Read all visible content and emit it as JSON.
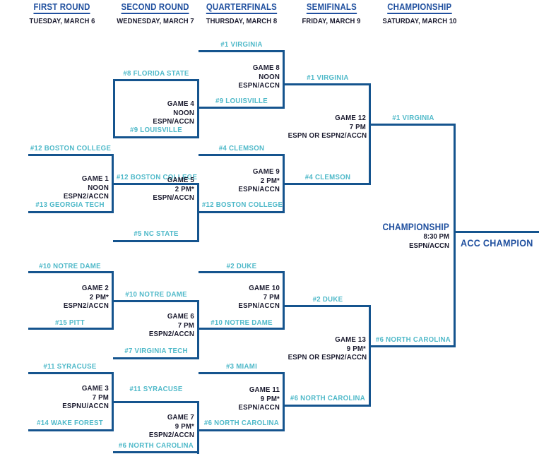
{
  "colors": {
    "header_blue": "#20509f",
    "line_navy": "#15548e",
    "team_teal": "#4fb9c9",
    "info_dark": "#1a1a2e",
    "background": "#ffffff"
  },
  "rounds": [
    {
      "title": "FIRST ROUND",
      "date": "TUESDAY, MARCH 6"
    },
    {
      "title": "SECOND ROUND",
      "date": "WEDNESDAY, MARCH 7"
    },
    {
      "title": "QUARTERFINALS",
      "date": "THURSDAY, MARCH 8"
    },
    {
      "title": "SEMIFINALS",
      "date": "FRIDAY, MARCH 9"
    },
    {
      "title": "CHAMPIONSHIP",
      "date": "SATURDAY, MARCH 10"
    }
  ],
  "games": {
    "g1": {
      "name": "GAME 1",
      "time": "NOON",
      "network": "ESPN2/ACCN",
      "top": "#12 BOSTON COLLEGE",
      "bottom": "#13 GEORGIA TECH",
      "winner": "#12 BOSTON COLLEGE"
    },
    "g2": {
      "name": "GAME 2",
      "time": "2 PM*",
      "network": "ESPN2/ACCN",
      "top": "#10 NOTRE DAME",
      "bottom": "#15 PITT",
      "winner": "#10 NOTRE DAME"
    },
    "g3": {
      "name": "GAME 3",
      "time": "7 PM",
      "network": "ESPNU/ACCN",
      "top": "#11 SYRACUSE",
      "bottom": "#14 WAKE FOREST",
      "winner": "#11 SYRACUSE"
    },
    "g4": {
      "name": "GAME 4",
      "time": "NOON",
      "network": "ESPN/ACCN",
      "top": "#8 FLORIDA STATE",
      "bottom": "#9 LOUISVILLE",
      "winner": "#9 LOUISVILLE"
    },
    "g5": {
      "name": "GAME 5",
      "time": "2 PM*",
      "network": "ESPN/ACCN",
      "top": "#12 BOSTON COLLEGE",
      "bottom": "#5 NC STATE",
      "winner": "#12 BOSTON COLLEGE"
    },
    "g6": {
      "name": "GAME 6",
      "time": "7 PM",
      "network": "ESPN2/ACCN",
      "top": "#10 NOTRE DAME",
      "bottom": "#7 VIRGINIA TECH",
      "winner": "#10 NOTRE DAME"
    },
    "g7": {
      "name": "GAME 7",
      "time": "9 PM*",
      "network": "ESPN2/ACCN",
      "top": "#11 SYRACUSE",
      "bottom": "#6 NORTH CAROLINA",
      "winner": "#6 NORTH CAROLINA"
    },
    "g8": {
      "name": "GAME 8",
      "time": "NOON",
      "network": "ESPN/ACCN",
      "top": "#1 VIRGINIA",
      "bottom": "#9 LOUISVILLE",
      "winner": "#1 VIRGINIA"
    },
    "g9": {
      "name": "GAME 9",
      "time": "2 PM*",
      "network": "ESPN/ACCN",
      "top": "#4 CLEMSON",
      "bottom": "#12 BOSTON COLLEGE",
      "winner": "#4 CLEMSON"
    },
    "g10": {
      "name": "GAME 10",
      "time": "7 PM",
      "network": "ESPN/ACCN",
      "top": "#2 DUKE",
      "bottom": "#10 NOTRE DAME",
      "winner": "#2 DUKE"
    },
    "g11": {
      "name": "GAME 11",
      "time": "9 PM*",
      "network": "ESPN/ACCN",
      "top": "#3 MIAMI",
      "bottom": "#6 NORTH CAROLINA",
      "winner": "#6 NORTH CAROLINA"
    },
    "g12": {
      "name": "GAME 12",
      "time": "7 PM",
      "network": "ESPN OR ESPN2/ACCN",
      "top": "#1 VIRGINIA",
      "bottom": "#4 CLEMSON",
      "winner": "#1 VIRGINIA"
    },
    "g13": {
      "name": "GAME 13",
      "time": "9 PM*",
      "network": "ESPN OR ESPN2/ACCN",
      "top": "#2 DUKE",
      "bottom": "#6 NORTH CAROLINA",
      "winner": "#6 NORTH CAROLINA"
    }
  },
  "championship": {
    "label": "CHAMPIONSHIP",
    "time": "8:30 PM",
    "network": "ESPN/ACCN",
    "top_seed": "#1 VIRGINIA",
    "bottom_seed": "#6 NORTH CAROLINA",
    "champion_label": "ACC CHAMPION"
  }
}
